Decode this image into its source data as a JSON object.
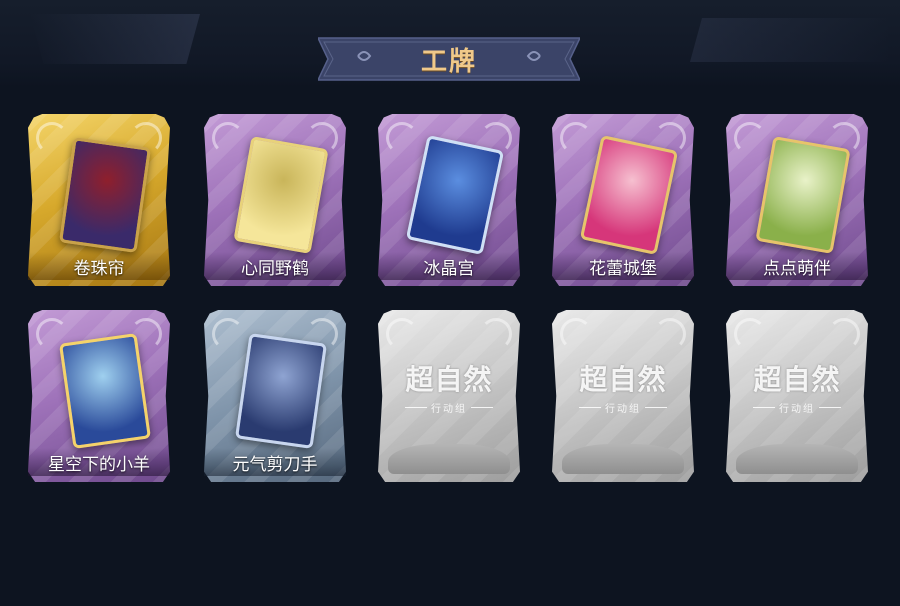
{
  "header": {
    "title": "工牌",
    "accent_color": "#f0c98a",
    "banner_color": "#3b4468"
  },
  "badges": [
    {
      "name": "卷珠帘",
      "rarity": "gold",
      "locked": false,
      "art_colors": [
        "#3a2a6a",
        "#8f1f2c",
        "#c9a24a"
      ]
    },
    {
      "name": "心同野鹤",
      "rarity": "purple",
      "locked": false,
      "art_colors": [
        "#f5e69a",
        "#c9b55a",
        "#e8d27a"
      ]
    },
    {
      "name": "冰晶宫",
      "rarity": "purple",
      "locked": false,
      "art_colors": [
        "#1f3b8f",
        "#5b8ee0",
        "#cfe0f5"
      ]
    },
    {
      "name": "花蕾城堡",
      "rarity": "purple",
      "locked": false,
      "art_colors": [
        "#d6367a",
        "#f6c0d0",
        "#e7c46a"
      ]
    },
    {
      "name": "点点萌伴",
      "rarity": "purple",
      "locked": false,
      "art_colors": [
        "#8ab04a",
        "#e9f2c9",
        "#e7c46a"
      ]
    },
    {
      "name": "星空下的小羊",
      "rarity": "purple",
      "locked": false,
      "art_colors": [
        "#2a4a9a",
        "#9fd0ef",
        "#f4d36a"
      ]
    },
    {
      "name": "元气剪刀手",
      "rarity": "blue",
      "locked": false,
      "art_colors": [
        "#2a3b70",
        "#8fa4d2",
        "#c8d6ef"
      ]
    },
    {
      "name": "",
      "rarity": "gray",
      "locked": true,
      "logo_main": "超自然",
      "logo_sub": "行动组"
    },
    {
      "name": "",
      "rarity": "gray",
      "locked": true,
      "logo_main": "超自然",
      "logo_sub": "行动组"
    },
    {
      "name": "",
      "rarity": "gray",
      "locked": true,
      "logo_main": "超自然",
      "logo_sub": "行动组"
    }
  ]
}
